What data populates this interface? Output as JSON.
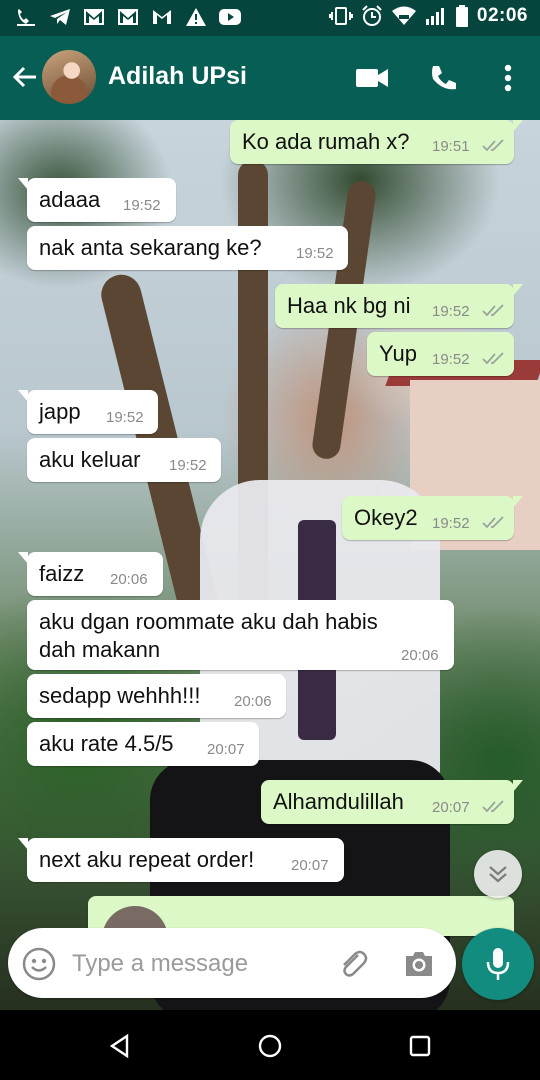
{
  "status_bar": {
    "time": "02:06"
  },
  "header": {
    "contact_name": "Adilah UPsi"
  },
  "messages": [
    {
      "dir": "out",
      "text": "Ko ada rumah x?",
      "time": "19:51",
      "read": true
    },
    {
      "dir": "in",
      "text": "adaaa",
      "time": "19:52"
    },
    {
      "dir": "in",
      "text": "nak anta sekarang ke?",
      "time": "19:52"
    },
    {
      "dir": "out",
      "text": "Haa nk bg ni",
      "time": "19:52",
      "read": true
    },
    {
      "dir": "out",
      "text": "Yup",
      "time": "19:52",
      "read": true
    },
    {
      "dir": "in",
      "text": "japp",
      "time": "19:52"
    },
    {
      "dir": "in",
      "text": "aku keluar",
      "time": "19:52"
    },
    {
      "dir": "out",
      "text": "Okey2",
      "time": "19:52",
      "read": true
    },
    {
      "dir": "in",
      "text": "faizz",
      "time": "20:06"
    },
    {
      "dir": "in",
      "text_line1": "aku dgan roommate aku dah habis",
      "text_line2": "dah makann",
      "time": "20:06"
    },
    {
      "dir": "in",
      "text": "sedapp wehhh!!!",
      "time": "20:06"
    },
    {
      "dir": "in",
      "text": "aku rate 4.5/5",
      "time": "20:07"
    },
    {
      "dir": "out",
      "text": "Alhamdulillah",
      "time": "20:07",
      "read": true
    },
    {
      "dir": "in",
      "text": "next aku repeat order!",
      "time": "20:07"
    }
  ],
  "input": {
    "placeholder": "Type a message"
  },
  "colors": {
    "header": "#075e54",
    "status_bar": "#06453e",
    "out_bubble": "#dcf8c6",
    "in_bubble": "#ffffff",
    "accent": "#128c7e",
    "read_ticks": "#9aa3a0"
  },
  "icons": {
    "status_left": [
      "wifi-calling-icon",
      "telegram-icon",
      "gmail-icon",
      "gmail-icon",
      "gmail-icon",
      "warning-icon",
      "youtube-icon"
    ],
    "status_right": [
      "vibrate-icon",
      "alarm-icon",
      "wifi-icon",
      "signal-icon",
      "battery-icon"
    ],
    "header": [
      "back-arrow-icon",
      "video-call-icon",
      "phone-icon",
      "more-vert-icon"
    ],
    "input": [
      "emoji-icon",
      "attach-icon",
      "camera-icon",
      "mic-icon"
    ],
    "nav": [
      "nav-back-icon",
      "nav-home-icon",
      "nav-recents-icon"
    ]
  }
}
